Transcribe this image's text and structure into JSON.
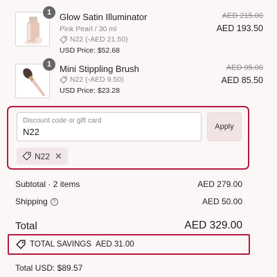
{
  "items": [
    {
      "name": "Glow Satin Illuminator",
      "variant": "Pink Pearl / 30 ml",
      "discount": "N22 (-AED 21.50)",
      "usd_price": "USD Price: $52.68",
      "original_price": "AED 215.00",
      "price": "AED 193.50",
      "quantity": "1",
      "thumb_icon": "illuminator-bottle-icon"
    },
    {
      "name": "Mini Stippling Brush",
      "variant": "",
      "discount": "N22 (-AED 9.50)",
      "usd_price": "USD Price: $23.28",
      "original_price": "AED 95.00",
      "price": "AED 85.50",
      "quantity": "1",
      "thumb_icon": "makeup-brush-icon"
    }
  ],
  "discount_form": {
    "placeholder": "Discount code or gift card",
    "value": "N22",
    "apply_label": "Apply",
    "applied_code": "N22"
  },
  "summary": {
    "subtotal_label": "Subtotal · 2 items",
    "subtotal_value": "AED 279.00",
    "shipping_label": "Shipping",
    "shipping_value": "AED 50.00",
    "total_label": "Total",
    "total_value": "AED 329.00",
    "savings_label": "TOTAL SAVINGS",
    "savings_value": "AED 31.00",
    "usd_total": "Total USD: $89.57"
  },
  "colors": {
    "background": "#fcf7f7",
    "highlight_border": "#b31b3c",
    "apply_button": "#f2e3e5",
    "chip": "#f1e7e8"
  }
}
